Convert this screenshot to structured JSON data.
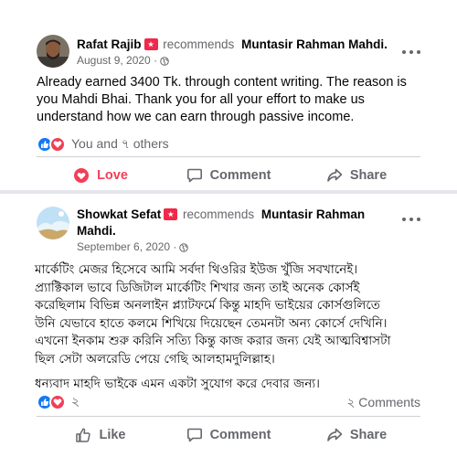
{
  "posts": [
    {
      "author": "Rafat Rajib",
      "verb": "recommends",
      "page": "Muntasir Rahman Mahdi.",
      "date": "August 9, 2020 ·",
      "text": "Already earned 3400 Tk. through content writing. The reason is you Mahdi Bhai. Thank you for all your effort to make us understand how we can earn through passive income.",
      "reactions_text": "You and ৭ others",
      "actions": {
        "love": "Love",
        "comment": "Comment",
        "share": "Share"
      }
    },
    {
      "author": "Showkat Sefat",
      "verb": "recommends",
      "page_line1": "Muntasir Rahman",
      "page_line2": "Mahdi.",
      "date": "September 6, 2020 ·",
      "paragraph1": [
        "মার্কেটিং মেজর হিসেবে আমি সর্বদা থিওরির ইউজ খুঁজি সবখানেই।",
        "প্র্যাক্টিকাল ভাবে  ডিজিটাল মার্কেটিং শিখার জন্য তাই অনেক কোর্সই",
        "করেছিলাম বিভিন্ন অনলাইন প্ল্যাটফর্মে কিন্তু মাহদি ভাইয়ের কোর্সগুলিতে",
        "উনি যেভাবে হাতে কলমে শিখিয়ে দিয়েছেন তেমনটা অন্য কোর্সে দেখিনি।",
        "এখনো ইনকাম শুরু করিনি সত্যি কিন্তু কাজ করার জন্য যেই আত্মবিশ্বাসটা",
        "ছিল সেটা অলরেডি পেয়ে গেছি আলহামদুলিল্লাহ।"
      ],
      "paragraph2": "ধন্যবাদ মাহদি ভাইকে এমন একটা সুযোগ করে দেবার জন্য।",
      "reactions_text": "২",
      "comments_text": "২ Comments",
      "actions": {
        "like": "Like",
        "comment": "Comment",
        "share": "Share"
      }
    }
  ],
  "colors": {
    "like_blue": "#1877f2",
    "love_red": "#f33e58",
    "secondary_text": "#65676b",
    "badge": "#f02849"
  },
  "icons": [
    "globe-icon",
    "more-options-icon",
    "like-reaction-icon",
    "love-reaction-icon",
    "heart-icon",
    "comment-icon",
    "share-icon",
    "thumbs-up-icon",
    "recommend-badge-icon"
  ]
}
